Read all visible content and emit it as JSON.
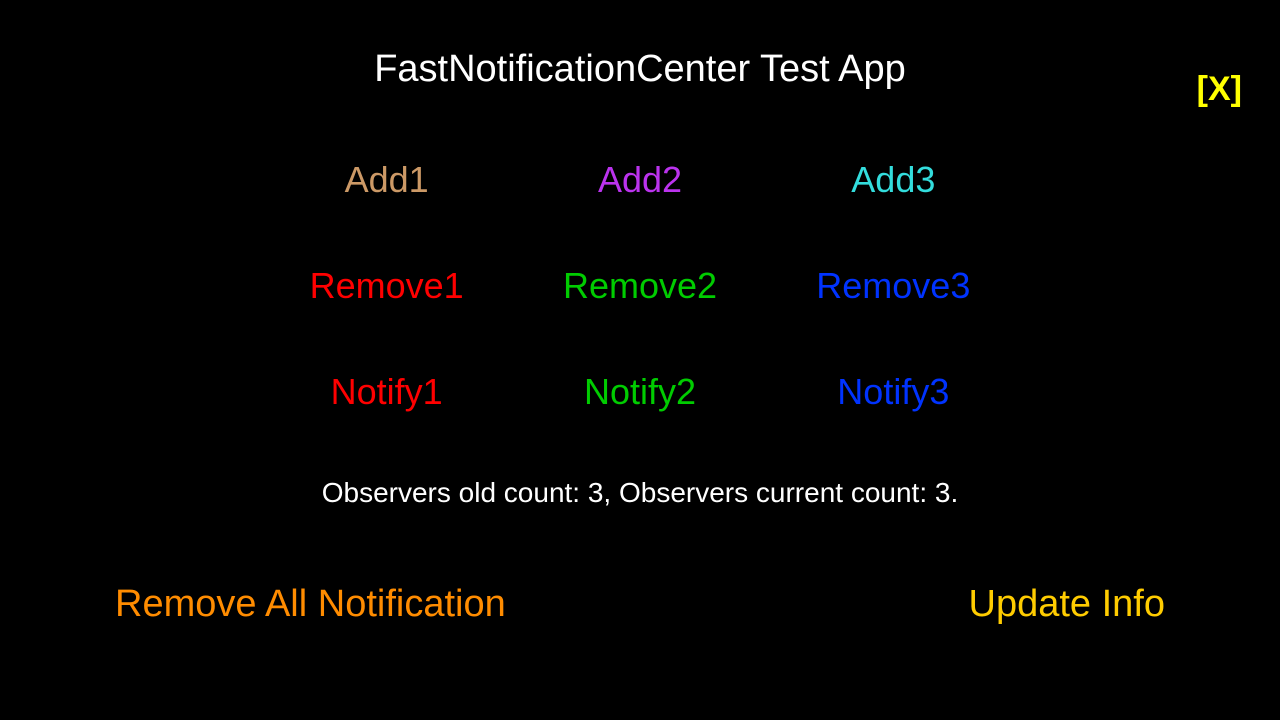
{
  "close_label": "[X]",
  "title": "FastNotificationCenter Test App",
  "colors": {
    "add1": "#cc9966",
    "add2": "#bb33ee",
    "add3": "#33dddd",
    "col1": "#ff0000",
    "col2": "#00cc00",
    "col3": "#0033ff",
    "remove_all": "#ff8c00",
    "update_info": "#ffcc00",
    "close": "#ffff00"
  },
  "buttons": {
    "add1": "Add1",
    "add2": "Add2",
    "add3": "Add3",
    "remove1": "Remove1",
    "remove2": "Remove2",
    "remove3": "Remove3",
    "notify1": "Notify1",
    "notify2": "Notify2",
    "notify3": "Notify3",
    "remove_all": "Remove All Notification",
    "update_info": "Update Info"
  },
  "status": {
    "old_count": 3,
    "current_count": 3,
    "text": "Observers old count: 3, Observers current count: 3."
  }
}
